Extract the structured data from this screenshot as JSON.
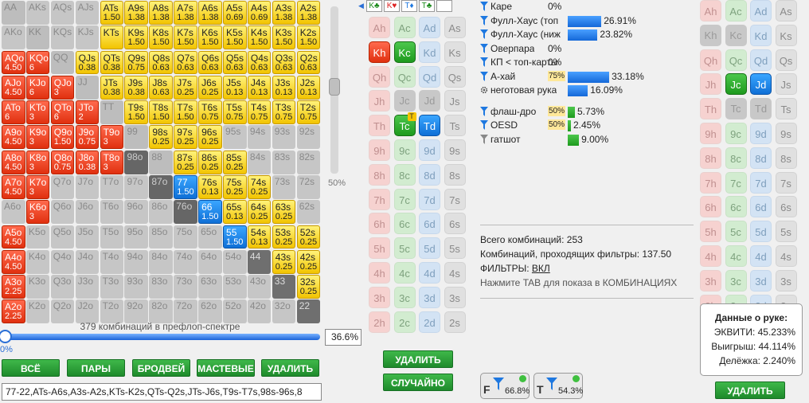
{
  "matrix": [
    [
      [
        "AA",
        "",
        "pair"
      ],
      [
        "AKs",
        "",
        "s"
      ],
      [
        "AQs",
        "",
        "s"
      ],
      [
        "AJs",
        "",
        "s"
      ],
      [
        "ATs",
        "1.50",
        "y"
      ],
      [
        "A9s",
        "1.38",
        "y"
      ],
      [
        "A8s",
        "1.38",
        "y"
      ],
      [
        "A7s",
        "1.38",
        "y"
      ],
      [
        "A6s",
        "1.38",
        "y"
      ],
      [
        "A5s",
        "0.69",
        "y"
      ],
      [
        "A4s",
        "0.69",
        "y"
      ],
      [
        "A3s",
        "1.38",
        "y"
      ],
      [
        "A2s",
        "1.38",
        "y"
      ]
    ],
    [
      [
        "AKo",
        "",
        "o"
      ],
      [
        "KK",
        "",
        "pair"
      ],
      [
        "KQs",
        "",
        "s"
      ],
      [
        "KJs",
        "",
        "s"
      ],
      [
        "KTs",
        "",
        "y"
      ],
      [
        "K9s",
        "1.50",
        "y"
      ],
      [
        "K8s",
        "1.50",
        "y"
      ],
      [
        "K7s",
        "1.50",
        "y"
      ],
      [
        "K6s",
        "1.50",
        "y"
      ],
      [
        "K5s",
        "1.50",
        "y"
      ],
      [
        "K4s",
        "1.50",
        "y"
      ],
      [
        "K3s",
        "1.50",
        "y"
      ],
      [
        "K2s",
        "1.50",
        "y"
      ]
    ],
    [
      [
        "AQo",
        "4.50",
        "r"
      ],
      [
        "KQo",
        "6",
        "r"
      ],
      [
        "QQ",
        "",
        "pair"
      ],
      [
        "QJs",
        "0.38",
        "y"
      ],
      [
        "QTs",
        "0.38",
        "y"
      ],
      [
        "Q9s",
        "0.75",
        "y"
      ],
      [
        "Q8s",
        "0.63",
        "y"
      ],
      [
        "Q7s",
        "0.63",
        "y"
      ],
      [
        "Q6s",
        "0.63",
        "y"
      ],
      [
        "Q5s",
        "0.63",
        "y"
      ],
      [
        "Q4s",
        "0.63",
        "y"
      ],
      [
        "Q3s",
        "0.63",
        "y"
      ],
      [
        "Q2s",
        "0.63",
        "y"
      ]
    ],
    [
      [
        "AJo",
        "4.50",
        "r"
      ],
      [
        "KJo",
        "6",
        "r"
      ],
      [
        "QJo",
        "3",
        "r"
      ],
      [
        "JJ",
        "",
        "pair"
      ],
      [
        "JTs",
        "0.38",
        "y"
      ],
      [
        "J9s",
        "0.38",
        "y"
      ],
      [
        "J8s",
        "0.63",
        "y"
      ],
      [
        "J7s",
        "0.25",
        "y"
      ],
      [
        "J6s",
        "0.25",
        "y"
      ],
      [
        "J5s",
        "0.13",
        "y"
      ],
      [
        "J4s",
        "0.13",
        "y"
      ],
      [
        "J3s",
        "0.13",
        "y"
      ],
      [
        "J2s",
        "0.13",
        "y"
      ]
    ],
    [
      [
        "ATo",
        "6",
        "r"
      ],
      [
        "KTo",
        "3",
        "r"
      ],
      [
        "QTo",
        "6",
        "r"
      ],
      [
        "JTo",
        "2",
        "r"
      ],
      [
        "TT",
        "",
        "pair"
      ],
      [
        "T9s",
        "1.50",
        "y"
      ],
      [
        "T8s",
        "1.50",
        "y"
      ],
      [
        "T7s",
        "1.50",
        "y"
      ],
      [
        "T6s",
        "0.75",
        "y"
      ],
      [
        "T5s",
        "0.75",
        "y"
      ],
      [
        "T4s",
        "0.75",
        "y"
      ],
      [
        "T3s",
        "0.75",
        "y"
      ],
      [
        "T2s",
        "0.75",
        "y"
      ]
    ],
    [
      [
        "A9o",
        "4.50",
        "r"
      ],
      [
        "K9o",
        "3",
        "r"
      ],
      [
        "Q9o",
        "1.50",
        "r"
      ],
      [
        "J9o",
        "0.75",
        "r"
      ],
      [
        "T9o",
        "3",
        "r"
      ],
      [
        "99",
        "",
        "pair"
      ],
      [
        "98s",
        "0.25",
        "y"
      ],
      [
        "97s",
        "0.25",
        "y"
      ],
      [
        "96s",
        "0.25",
        "y"
      ],
      [
        "95s",
        "",
        "s"
      ],
      [
        "94s",
        "",
        "s"
      ],
      [
        "93s",
        "",
        "s"
      ],
      [
        "92s",
        "",
        "s"
      ]
    ],
    [
      [
        "A8o",
        "4.50",
        "r"
      ],
      [
        "K8o",
        "3",
        "r"
      ],
      [
        "Q8o",
        "0.75",
        "r"
      ],
      [
        "J8o",
        "0.38",
        "r"
      ],
      [
        "T8o",
        "3",
        "r"
      ],
      [
        "98o",
        "",
        "dk"
      ],
      [
        "88",
        "",
        "pair"
      ],
      [
        "87s",
        "0.25",
        "y"
      ],
      [
        "86s",
        "0.25",
        "y"
      ],
      [
        "85s",
        "0.25",
        "y"
      ],
      [
        "84s",
        "",
        "s"
      ],
      [
        "83s",
        "",
        "s"
      ],
      [
        "82s",
        "",
        "s"
      ]
    ],
    [
      [
        "A7o",
        "4.50",
        "r"
      ],
      [
        "K7o",
        "3",
        "r"
      ],
      [
        "Q7o",
        "",
        "o"
      ],
      [
        "J7o",
        "",
        "o"
      ],
      [
        "T7o",
        "",
        "o"
      ],
      [
        "97o",
        "",
        "o"
      ],
      [
        "87o",
        "",
        "dk"
      ],
      [
        "77",
        "1.50",
        "b"
      ],
      [
        "76s",
        "0.13",
        "y"
      ],
      [
        "75s",
        "0.25",
        "y"
      ],
      [
        "74s",
        "0.25",
        "y"
      ],
      [
        "73s",
        "",
        "s"
      ],
      [
        "72s",
        "",
        "s"
      ]
    ],
    [
      [
        "A6o",
        "",
        "o"
      ],
      [
        "K6o",
        "3",
        "r"
      ],
      [
        "Q6o",
        "",
        "o"
      ],
      [
        "J6o",
        "",
        "o"
      ],
      [
        "T6o",
        "",
        "o"
      ],
      [
        "96o",
        "",
        "o"
      ],
      [
        "86o",
        "",
        "o"
      ],
      [
        "76o",
        "",
        "dk"
      ],
      [
        "66",
        "1.50",
        "b"
      ],
      [
        "65s",
        "0.13",
        "y"
      ],
      [
        "64s",
        "0.25",
        "y"
      ],
      [
        "63s",
        "0.25",
        "y"
      ],
      [
        "62s",
        "",
        "s"
      ]
    ],
    [
      [
        "A5o",
        "4.50",
        "r"
      ],
      [
        "K5o",
        "",
        "o"
      ],
      [
        "Q5o",
        "",
        "o"
      ],
      [
        "J5o",
        "",
        "o"
      ],
      [
        "T5o",
        "",
        "o"
      ],
      [
        "95o",
        "",
        "o"
      ],
      [
        "85o",
        "",
        "o"
      ],
      [
        "75o",
        "",
        "o"
      ],
      [
        "65o",
        "",
        "o"
      ],
      [
        "55",
        "1.50",
        "b"
      ],
      [
        "54s",
        "0.13",
        "y"
      ],
      [
        "53s",
        "0.25",
        "y"
      ],
      [
        "52s",
        "0.25",
        "y"
      ]
    ],
    [
      [
        "A4o",
        "4.50",
        "r"
      ],
      [
        "K4o",
        "",
        "o"
      ],
      [
        "Q4o",
        "",
        "o"
      ],
      [
        "J4o",
        "",
        "o"
      ],
      [
        "T4o",
        "",
        "o"
      ],
      [
        "94o",
        "",
        "o"
      ],
      [
        "84o",
        "",
        "o"
      ],
      [
        "74o",
        "",
        "o"
      ],
      [
        "64o",
        "",
        "o"
      ],
      [
        "54o",
        "",
        "o"
      ],
      [
        "44",
        "",
        "d"
      ],
      [
        "43s",
        "0.25",
        "y"
      ],
      [
        "42s",
        "0.25",
        "y"
      ]
    ],
    [
      [
        "A3o",
        "2.25",
        "r"
      ],
      [
        "K3o",
        "",
        "o"
      ],
      [
        "Q3o",
        "",
        "o"
      ],
      [
        "J3o",
        "",
        "o"
      ],
      [
        "T3o",
        "",
        "o"
      ],
      [
        "93o",
        "",
        "o"
      ],
      [
        "83o",
        "",
        "o"
      ],
      [
        "73o",
        "",
        "o"
      ],
      [
        "63o",
        "",
        "o"
      ],
      [
        "53o",
        "",
        "o"
      ],
      [
        "43o",
        "",
        "o"
      ],
      [
        "33",
        "",
        "d"
      ],
      [
        "32s",
        "0.25",
        "y"
      ]
    ],
    [
      [
        "A2o",
        "2.25",
        "r"
      ],
      [
        "K2o",
        "",
        "o"
      ],
      [
        "Q2o",
        "",
        "o"
      ],
      [
        "J2o",
        "",
        "o"
      ],
      [
        "T2o",
        "",
        "o"
      ],
      [
        "92o",
        "",
        "o"
      ],
      [
        "82o",
        "",
        "o"
      ],
      [
        "72o",
        "",
        "o"
      ],
      [
        "62o",
        "",
        "o"
      ],
      [
        "52o",
        "",
        "o"
      ],
      [
        "42o",
        "",
        "o"
      ],
      [
        "32o",
        "",
        "o"
      ],
      [
        "22",
        "",
        "d"
      ]
    ]
  ],
  "vslider_label": "50%",
  "combo_caption": "379 комбинаций в префлоп-спектре",
  "hslider_min": "0%",
  "range_percent": "36.6%",
  "range_fraction": 0.366,
  "buttons": {
    "all": "ВСЁ",
    "pairs": "ПАРЫ",
    "broadway": "БРОДВЕЙ",
    "suited": "МАСТЕВЫЕ",
    "delete": "УДАЛИТЬ"
  },
  "range_text": "77-22,ATs-A6s,A3s-A2s,KTs-K2s,QTs-Q2s,JTs-J6s,T9s-T7s,98s-96s,8",
  "board_slots": [
    "K♣",
    "K♥",
    "T♦",
    "T♣",
    ""
  ],
  "board_grid": [
    [
      [
        "Ah",
        "h"
      ],
      [
        "Ac",
        "c"
      ],
      [
        "Ad",
        "d"
      ],
      [
        "As",
        "s"
      ]
    ],
    [
      [
        "Kh",
        "Rh"
      ],
      [
        "Kc",
        "Gc"
      ],
      [
        "Kd",
        "d"
      ],
      [
        "Ks",
        "s"
      ]
    ],
    [
      [
        "Qh",
        "h"
      ],
      [
        "Qc",
        "c"
      ],
      [
        "Qd",
        "d"
      ],
      [
        "Qs",
        "s"
      ]
    ],
    [
      [
        "Jh",
        "h"
      ],
      [
        "Jc",
        "dim"
      ],
      [
        "Jd",
        "dim"
      ],
      [
        "Js",
        "s"
      ]
    ],
    [
      [
        "Th",
        "h"
      ],
      [
        "Tc",
        "Gc",
        "T"
      ],
      [
        "Td",
        "Bd"
      ],
      [
        "Ts",
        "s"
      ]
    ],
    [
      [
        "9h",
        "h"
      ],
      [
        "9c",
        "c"
      ],
      [
        "9d",
        "d"
      ],
      [
        "9s",
        "s"
      ]
    ],
    [
      [
        "8h",
        "h"
      ],
      [
        "8c",
        "c"
      ],
      [
        "8d",
        "d"
      ],
      [
        "8s",
        "s"
      ]
    ],
    [
      [
        "7h",
        "h"
      ],
      [
        "7c",
        "c"
      ],
      [
        "7d",
        "d"
      ],
      [
        "7s",
        "s"
      ]
    ],
    [
      [
        "6h",
        "h"
      ],
      [
        "6c",
        "c"
      ],
      [
        "6d",
        "d"
      ],
      [
        "6s",
        "s"
      ]
    ],
    [
      [
        "5h",
        "h"
      ],
      [
        "5c",
        "c"
      ],
      [
        "5d",
        "d"
      ],
      [
        "5s",
        "s"
      ]
    ],
    [
      [
        "4h",
        "h"
      ],
      [
        "4c",
        "c"
      ],
      [
        "4d",
        "d"
      ],
      [
        "4s",
        "s"
      ]
    ],
    [
      [
        "3h",
        "h"
      ],
      [
        "3c",
        "c"
      ],
      [
        "3d",
        "d"
      ],
      [
        "3s",
        "s"
      ]
    ],
    [
      [
        "2h",
        "h"
      ],
      [
        "2c",
        "c"
      ],
      [
        "2d",
        "d"
      ],
      [
        "2s",
        "s"
      ]
    ]
  ],
  "board_buttons": {
    "delete": "УДАЛИТЬ",
    "random": "СЛУЧАЙНО"
  },
  "stats": [
    {
      "label": "Каре",
      "value": "0%",
      "bar": 0,
      "icon": "blue"
    },
    {
      "label": "Фулл-Хаус (топ",
      "value": "26.91%",
      "bar": 26.91,
      "icon": "blue"
    },
    {
      "label": "Фулл-Хаус (ниж",
      "value": "23.82%",
      "bar": 23.82,
      "icon": "blue"
    },
    {
      "label": "Оверпара",
      "value": "0%",
      "bar": 0,
      "icon": "blue"
    },
    {
      "label": "КП < топ-карты",
      "value": "0%",
      "bar": 0,
      "icon": "blue"
    },
    {
      "label": "А-хай",
      "value": "33.18%",
      "bar": 33.18,
      "pct": "75%",
      "icon": "blue"
    },
    {
      "label": "неготовая рука",
      "value": "16.09%",
      "bar": 16.09,
      "icon": "gear"
    }
  ],
  "draws": [
    {
      "label": "флаш-дро",
      "value": "5.73%",
      "bar": 5.73,
      "pct": "50%",
      "icon": "blue"
    },
    {
      "label": "OESD",
      "value": "2.45%",
      "bar": 2.45,
      "pct": "50%",
      "icon": "blue"
    },
    {
      "label": "гатшот",
      "value": "9.00%",
      "bar": 9.0,
      "icon": "gray"
    }
  ],
  "summary": {
    "total": "Всего комбинаций: 253",
    "filtered": "Комбинаций, проходящих фильтры: 137.50",
    "filters_label": "ФИЛЬТРЫ: ",
    "filters_value": "ВКЛ",
    "hint": "Нажмите TAB для показа в КОМБИНАЦИЯХ"
  },
  "filter_buttons": [
    {
      "letter": "F",
      "pct": "66.8%"
    },
    {
      "letter": "T",
      "pct": "54.3%"
    }
  ],
  "hero_grid": [
    [
      [
        "Ah",
        "h"
      ],
      [
        "Ac",
        "c"
      ],
      [
        "Ad",
        "d"
      ],
      [
        "As",
        "s"
      ]
    ],
    [
      [
        "Kh",
        "dim"
      ],
      [
        "Kc",
        "dim"
      ],
      [
        "Kd",
        "d"
      ],
      [
        "Ks",
        "s"
      ]
    ],
    [
      [
        "Qh",
        "h"
      ],
      [
        "Qc",
        "c"
      ],
      [
        "Qd",
        "d"
      ],
      [
        "Qs",
        "s"
      ]
    ],
    [
      [
        "Jh",
        "h"
      ],
      [
        "Jc",
        "Gc"
      ],
      [
        "Jd",
        "Bd"
      ],
      [
        "Js",
        "s"
      ]
    ],
    [
      [
        "Th",
        "h"
      ],
      [
        "Tc",
        "dim"
      ],
      [
        "Td",
        "dim"
      ],
      [
        "Ts",
        "s"
      ]
    ],
    [
      [
        "9h",
        "h"
      ],
      [
        "9c",
        "c"
      ],
      [
        "9d",
        "d"
      ],
      [
        "9s",
        "s"
      ]
    ],
    [
      [
        "8h",
        "h"
      ],
      [
        "8c",
        "c"
      ],
      [
        "8d",
        "d"
      ],
      [
        "8s",
        "s"
      ]
    ],
    [
      [
        "7h",
        "h"
      ],
      [
        "7c",
        "c"
      ],
      [
        "7d",
        "d"
      ],
      [
        "7s",
        "s"
      ]
    ],
    [
      [
        "6h",
        "h"
      ],
      [
        "6c",
        "c"
      ],
      [
        "6d",
        "d"
      ],
      [
        "6s",
        "s"
      ]
    ],
    [
      [
        "5h",
        "h"
      ],
      [
        "5c",
        "c"
      ],
      [
        "5d",
        "d"
      ],
      [
        "5s",
        "s"
      ]
    ],
    [
      [
        "4h",
        "h"
      ],
      [
        "4c",
        "c"
      ],
      [
        "4d",
        "d"
      ],
      [
        "4s",
        "s"
      ]
    ],
    [
      [
        "3h",
        "h"
      ],
      [
        "3c",
        "c"
      ],
      [
        "3d",
        "d"
      ],
      [
        "3s",
        "s"
      ]
    ],
    [
      [
        "2h",
        "h"
      ],
      [
        "2c",
        "c"
      ],
      [
        "2d",
        "d"
      ],
      [
        "2s",
        "s"
      ]
    ]
  ],
  "hand_data": {
    "title": "Данные о руке:",
    "equity": "ЭКВИТИ: 45.233%",
    "win": "Выигрыш: 44.114%",
    "tie": "Делёжка: 2.240%"
  },
  "hero_delete": "УДАЛИТЬ"
}
